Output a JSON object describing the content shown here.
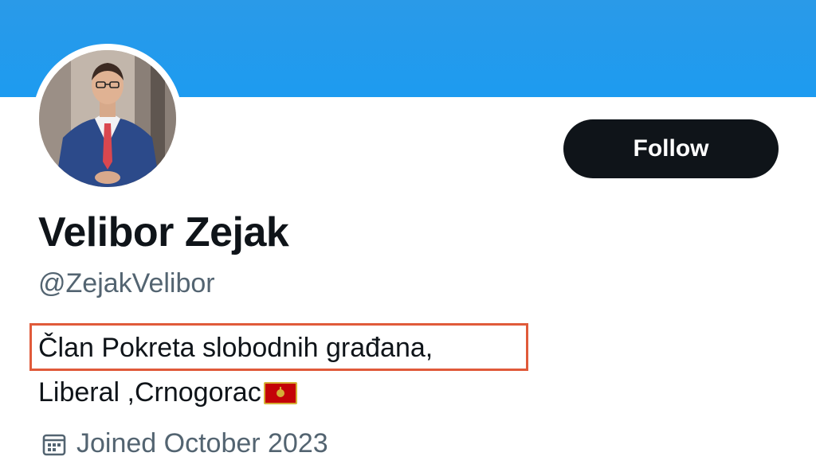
{
  "profile": {
    "display_name": "Velibor Zejak",
    "handle": "@ZejakVelibor",
    "bio_line_1": "Član Pokreta slobodnih građana,",
    "bio_line_2": "Liberal ,Crnogorac",
    "joined": "Joined October 2023"
  },
  "actions": {
    "follow_label": "Follow"
  },
  "icons": {
    "calendar": "calendar-icon",
    "flag": "montenegro-flag-icon"
  },
  "colors": {
    "banner": "#1d9bf0",
    "follow_bg": "#0f1419",
    "secondary_text": "#536471",
    "highlight": "#e05a3a"
  }
}
